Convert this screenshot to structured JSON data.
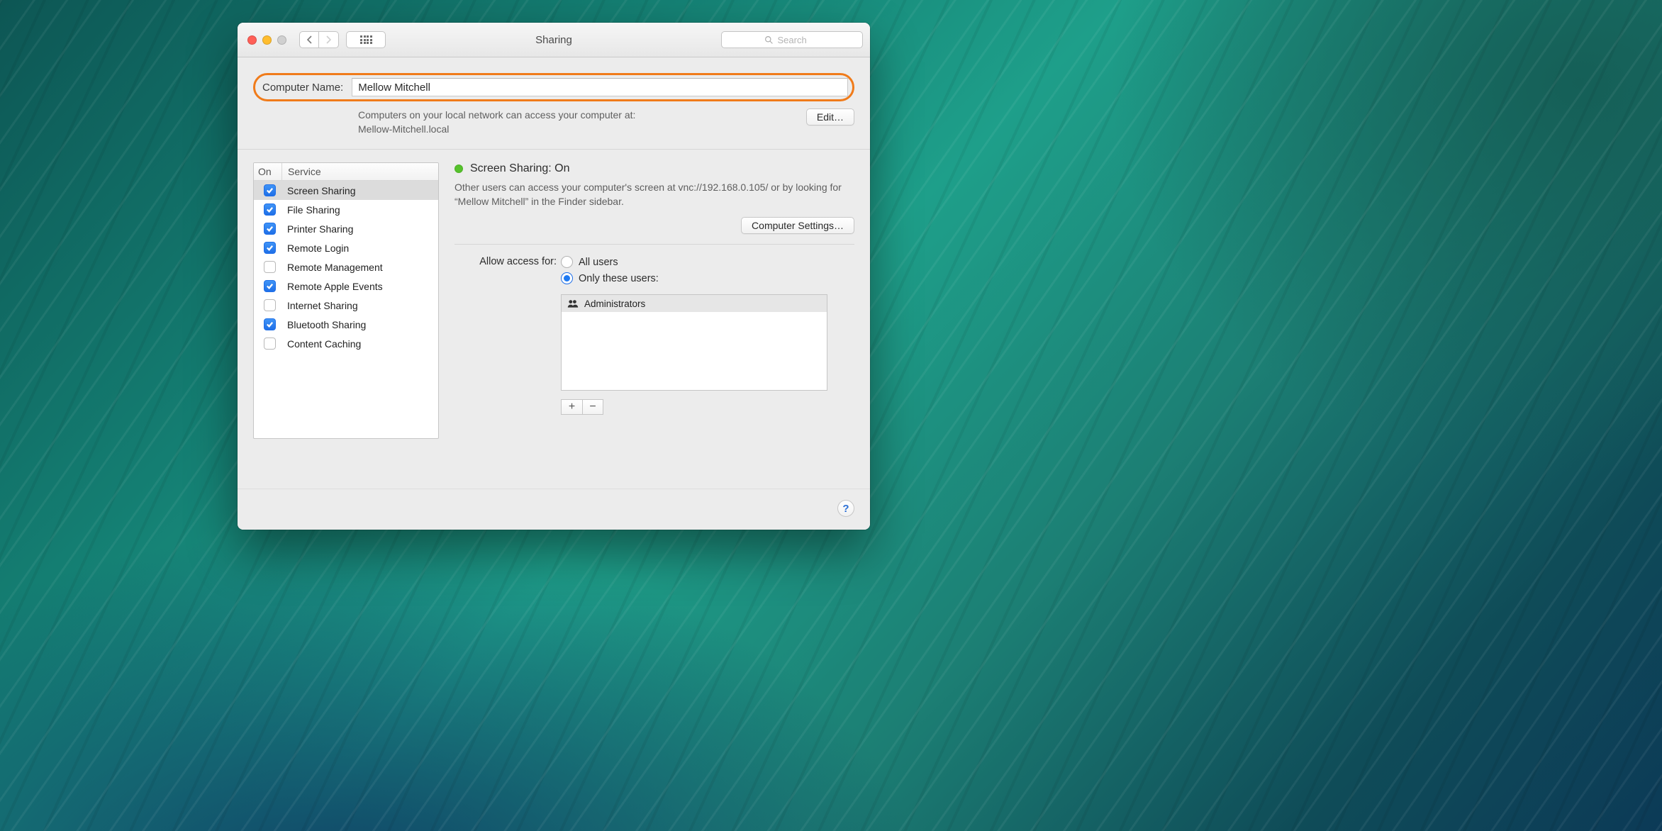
{
  "titlebar": {
    "title": "Sharing",
    "search_placeholder": "Search"
  },
  "top": {
    "label": "Computer Name:",
    "value": "Mellow Mitchell",
    "sub_line1": "Computers on your local network can access your computer at:",
    "sub_line2": "Mellow-Mitchell.local",
    "edit": "Edit…"
  },
  "service_header": {
    "on": "On",
    "service": "Service"
  },
  "services": [
    {
      "label": "Screen Sharing",
      "checked": true,
      "selected": true
    },
    {
      "label": "File Sharing",
      "checked": true,
      "selected": false
    },
    {
      "label": "Printer Sharing",
      "checked": true,
      "selected": false
    },
    {
      "label": "Remote Login",
      "checked": true,
      "selected": false
    },
    {
      "label": "Remote Management",
      "checked": false,
      "selected": false
    },
    {
      "label": "Remote Apple Events",
      "checked": true,
      "selected": false
    },
    {
      "label": "Internet Sharing",
      "checked": false,
      "selected": false
    },
    {
      "label": "Bluetooth Sharing",
      "checked": true,
      "selected": false
    },
    {
      "label": "Content Caching",
      "checked": false,
      "selected": false
    }
  ],
  "detail": {
    "status_title": "Screen Sharing: On",
    "description": "Other users can access your computer's screen at vnc://192.168.0.105/ or by looking for “Mellow Mitchell” in the Finder sidebar.",
    "settings_btn": "Computer Settings…",
    "access_label": "Allow access for:",
    "radio_all": "All users",
    "radio_only": "Only these users:",
    "users": [
      "Administrators"
    ]
  },
  "help": "?"
}
